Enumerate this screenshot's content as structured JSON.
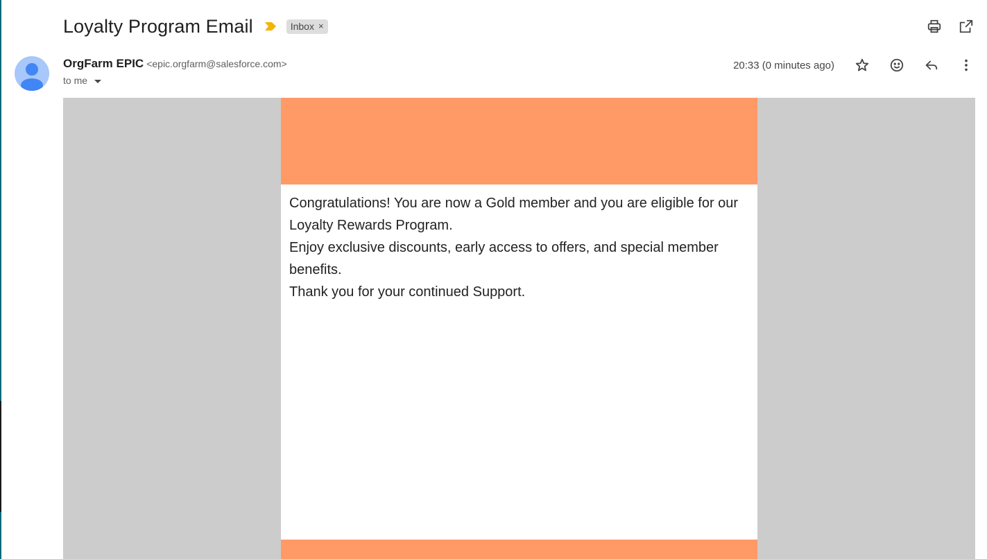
{
  "message": {
    "subject": "Loyalty Program Email",
    "label": "Inbox",
    "label_remove": "×",
    "sender_name": "OrgFarm EPIC",
    "sender_email": "<epic.orgfarm@salesforce.com>",
    "recipient": "to me",
    "timestamp": "20:33 (0 minutes ago)"
  },
  "icons": {
    "importance": "importance-marker-icon",
    "print": "print-icon",
    "open_new_window": "open-in-new-window-icon",
    "star": "star-icon",
    "emoji": "emoji-reaction-icon",
    "reply": "reply-icon",
    "more": "more-vert-icon",
    "avatar": "default-avatar-icon",
    "details": "chevron-down-icon"
  },
  "body": {
    "paragraphs": [
      "Congratulations! You are now a Gold member and you are eligible for our Loyalty Rewards Program.",
      "Enjoy exclusive discounts, early access to offers, and special member benefits.",
      "Thank you for your continued Support."
    ]
  },
  "colors": {
    "accent_band": "#ff9966",
    "email_backdrop": "#cccccc",
    "importance_marker": "#f4b400",
    "avatar_background": "#a8c7fa",
    "avatar_figure": "#4285f4"
  }
}
